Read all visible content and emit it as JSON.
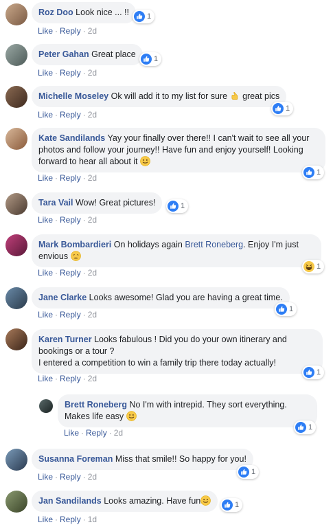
{
  "comments": [
    {
      "author": "Roz Doo",
      "text": "Look nice ... !!",
      "reaction": "like",
      "reaction_count": "1",
      "like": "Like",
      "reply": "Reply",
      "time": "2d"
    },
    {
      "author": "Peter Gahan",
      "text": "Great place",
      "reaction": "like",
      "reaction_count": "1",
      "like": "Like",
      "reply": "Reply",
      "time": "2d"
    },
    {
      "author": "Michelle Moseley",
      "text": "Ok will add it to my list for sure",
      "text_after_emoji": " great pics",
      "emoji": "pointing-hand-emoji",
      "reaction": "like",
      "reaction_count": "1",
      "like": "Like",
      "reply": "Reply",
      "time": "2d"
    },
    {
      "author": "Kate Sandilands",
      "text": "Yay your finally over there!! I can't wait to see all your photos and follow your journey!! Have fun and enjoy yourself! Looking forward to hear all about it",
      "emoji": "smile-emoji",
      "reaction": "like",
      "reaction_count": "1",
      "like": "Like",
      "reply": "Reply",
      "time": "2d"
    },
    {
      "author": "Tara Vail",
      "text": "Wow! Great pictures!",
      "reaction": "like",
      "reaction_count": "1",
      "like": "Like",
      "reply": "Reply",
      "time": "2d"
    },
    {
      "author": "Mark Bombardieri",
      "text_before_mention": "On holidays again ",
      "mention": "Brett Roneberg",
      "text": ". Enjoy I'm just envious",
      "emoji": "tired-emoji",
      "reaction": "haha",
      "reaction_count": "1",
      "like": "Like",
      "reply": "Reply",
      "time": "2d"
    },
    {
      "author": "Jane Clarke",
      "text": "Looks awesome! Glad you are having a great time.",
      "reaction": "like",
      "reaction_count": "1",
      "like": "Like",
      "reply": "Reply",
      "time": "2d"
    },
    {
      "author": "Karen Turner",
      "text": "Looks fabulous ! Did you do your own itinerary and bookings or a tour ?",
      "text_line2": "I entered a competition to win a family trip there today actually!",
      "reaction": "like",
      "reaction_count": "1",
      "like": "Like",
      "reply": "Reply",
      "time": "2d"
    },
    {
      "author": "Brett Roneberg",
      "text": "No I'm with intrepid. They sort everything. Makes life easy",
      "emoji": "smile-emoji",
      "reaction": "like",
      "reaction_count": "1",
      "like": "Like",
      "reply": "Reply",
      "time": "2d"
    },
    {
      "author": "Susanna Foreman",
      "text": "Miss that smile!! So happy for you!",
      "reaction": "like",
      "reaction_count": "1",
      "like": "Like",
      "reply": "Reply",
      "time": "2d"
    },
    {
      "author": "Jan Sandilands",
      "text": "Looks amazing. Have fun",
      "emoji": "smile-emoji",
      "reaction": "like",
      "reaction_count": "1",
      "like": "Like",
      "reply": "Reply",
      "time": "1d"
    }
  ],
  "colors": {
    "link": "#385898",
    "bubble": "#f2f3f5",
    "muted": "#90949c",
    "like_blue": "#2e7ef5",
    "emoji_yellow": "#f7c948"
  }
}
